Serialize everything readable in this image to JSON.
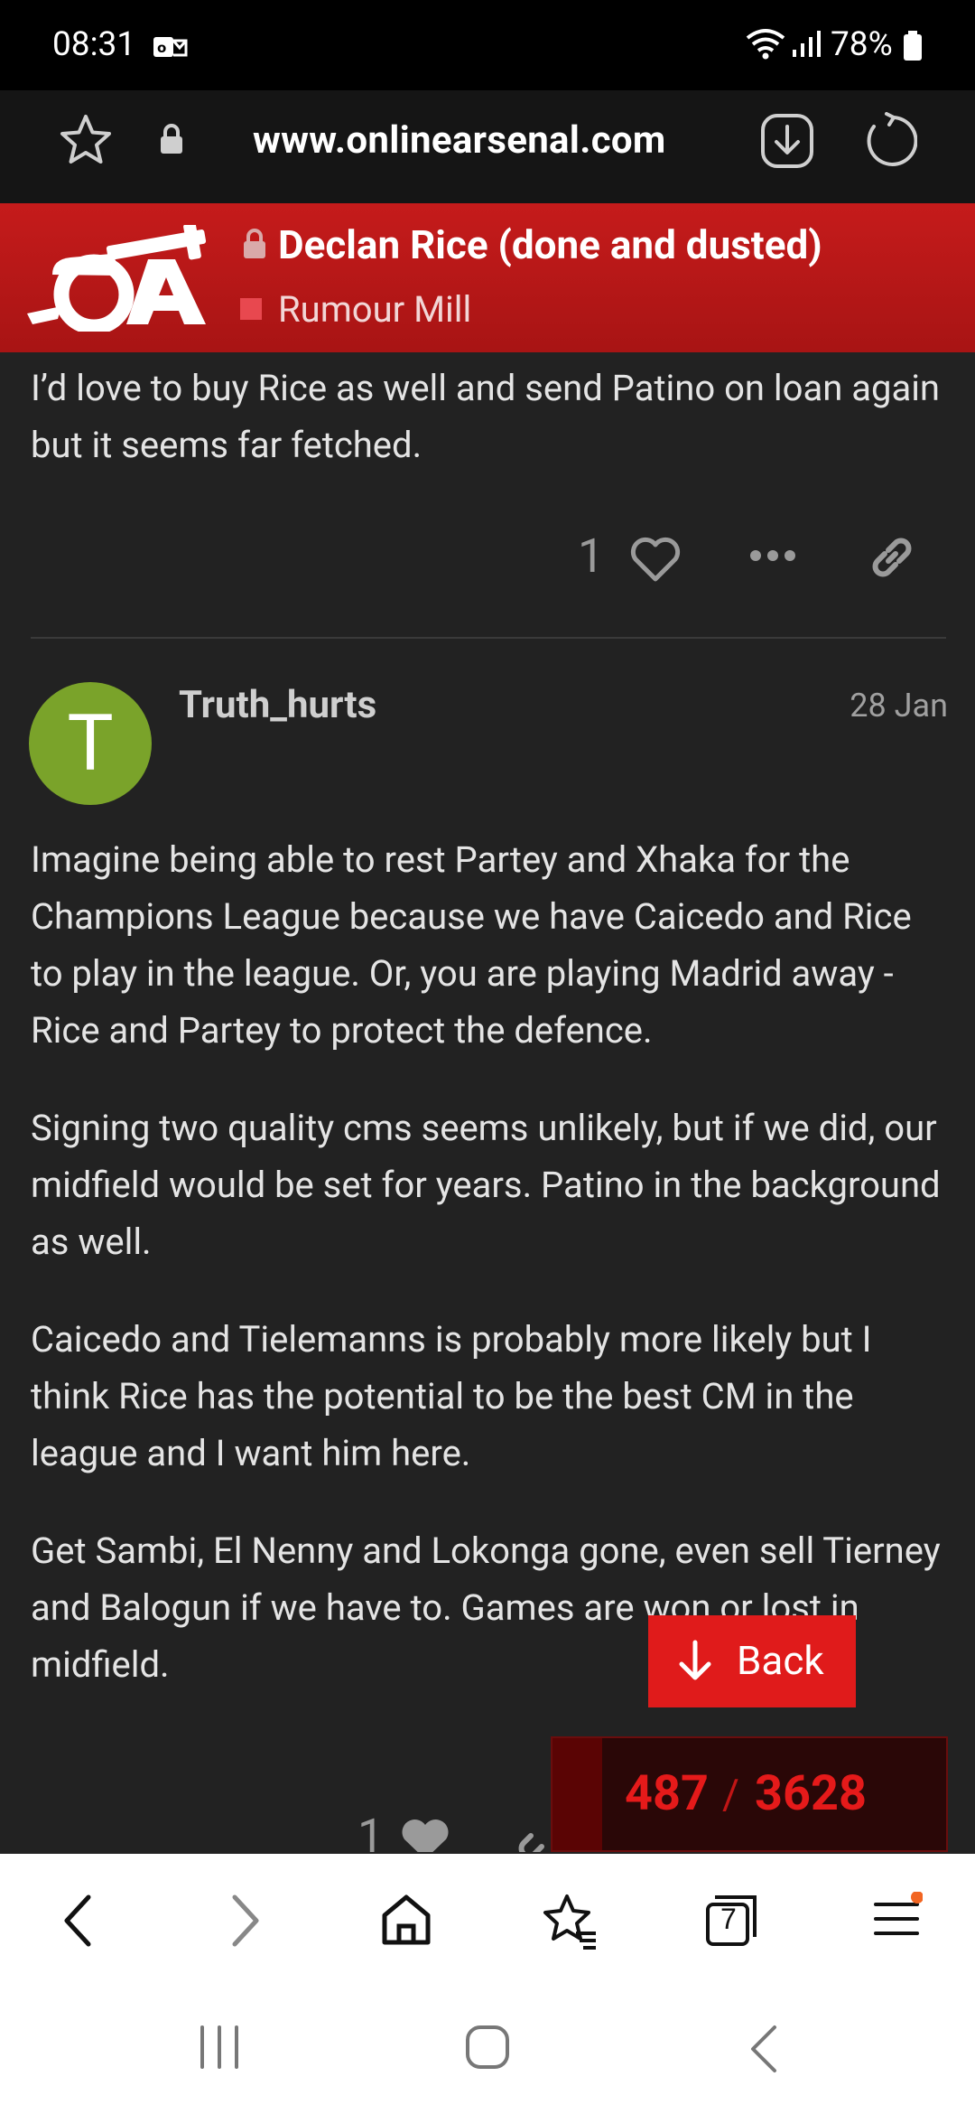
{
  "status_bar": {
    "time": "08:31",
    "battery": "78%"
  },
  "browser": {
    "url": "www.onlinearsenal.com",
    "tab_count": "7"
  },
  "header": {
    "logo_text": "OA",
    "topic_title": "Declan Rice (done and dusted)",
    "category": "Rumour Mill",
    "category_color": "#e8484f"
  },
  "previous_post": {
    "text": "I’d love to buy Rice as well and send Patino on loan again but it seems far fetched.",
    "likes": "1"
  },
  "post": {
    "author_initial": "T",
    "author": "Truth_hurts",
    "date": "28 Jan",
    "paragraphs": [
      "Imagine being able to rest Partey and Xhaka for the Champions League because we have Caicedo and Rice to play in the league. Or, you are playing Madrid away - Rice and Partey to protect the defence.",
      "Signing two quality cms seems unlikely, but if we did, our midfield would be set for years. Patino in the background as well.",
      "Caicedo and Tielemanns is probably more likely but I think Rice has the potential to be the best CM in the league and I want him here.",
      "Get Sambi, El Nenny and Lokonga gone, even sell Tierney and Balogun if we have to. Games are won or lost in midfield."
    ],
    "likes": "1"
  },
  "back_button": {
    "label": "Back"
  },
  "progress": {
    "current": "487",
    "separator": "/",
    "total": "3628"
  },
  "colors": {
    "accent": "#c51b1b",
    "avatar": "#7aa32a"
  }
}
